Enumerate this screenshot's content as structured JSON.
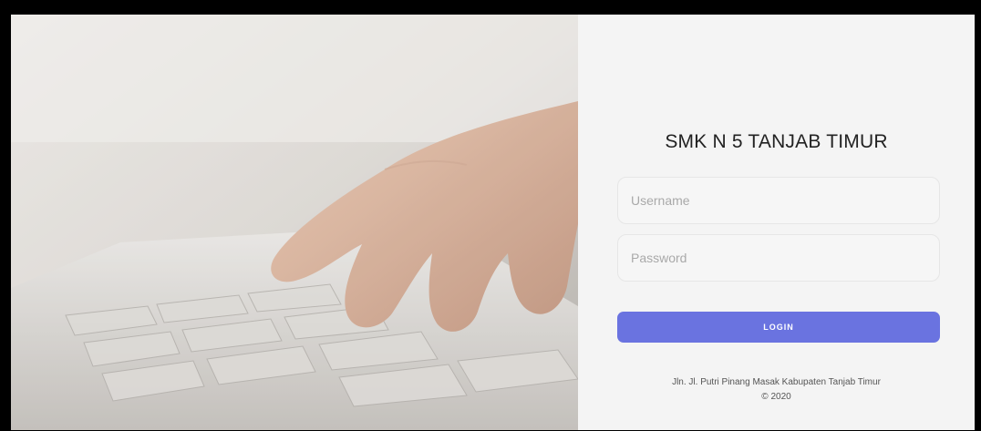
{
  "school_name": "SMK N 5 TANJAB TIMUR",
  "form": {
    "username_placeholder": "Username",
    "password_placeholder": "Password",
    "username_value": "",
    "password_value": "",
    "login_label": "LOGIN"
  },
  "footer": {
    "address": "Jln. Jl. Putri Pinang Masak Kabupaten Tanjab Timur",
    "copyright": "© 2020"
  },
  "colors": {
    "accent": "#6a73e0",
    "panel_background": "#f4f4f4"
  },
  "icons": [
    "keyboard-typing-photo"
  ]
}
